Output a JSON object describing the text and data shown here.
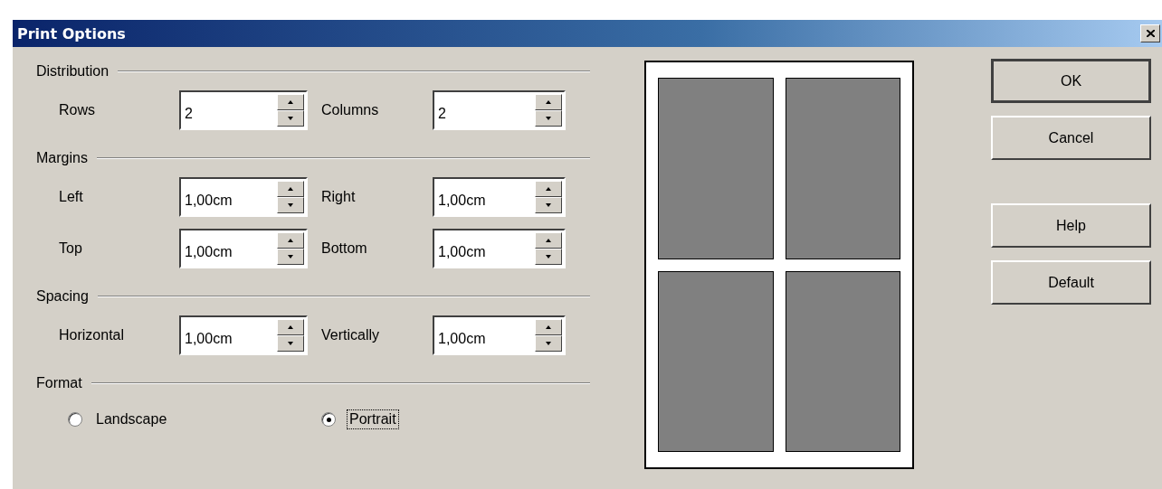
{
  "window": {
    "title": "Print Options"
  },
  "sections": [
    {
      "heading": "Distribution",
      "fields": [
        {
          "label": "Rows",
          "value": "2"
        },
        {
          "label": "Columns",
          "value": "2"
        }
      ]
    },
    {
      "heading": "Margins",
      "fields": [
        {
          "label": "Left",
          "value": "1,00cm"
        },
        {
          "label": "Right",
          "value": "1,00cm"
        },
        {
          "label": "Top",
          "value": "1,00cm"
        },
        {
          "label": "Bottom",
          "value": "1,00cm"
        }
      ]
    },
    {
      "heading": "Spacing",
      "fields": [
        {
          "label": "Horizontal",
          "value": "1,00cm"
        },
        {
          "label": "Vertically",
          "value": "1,00cm"
        }
      ]
    }
  ],
  "format": {
    "heading": "Format",
    "options": [
      {
        "label": "Landscape",
        "selected": false,
        "focused": false
      },
      {
        "label": "Portrait",
        "selected": true,
        "focused": true
      }
    ]
  },
  "buttons": [
    {
      "label": "OK",
      "default": true
    },
    {
      "label": "Cancel",
      "default": false
    },
    {
      "label": "Help",
      "default": false
    },
    {
      "label": "Default",
      "default": false
    }
  ]
}
